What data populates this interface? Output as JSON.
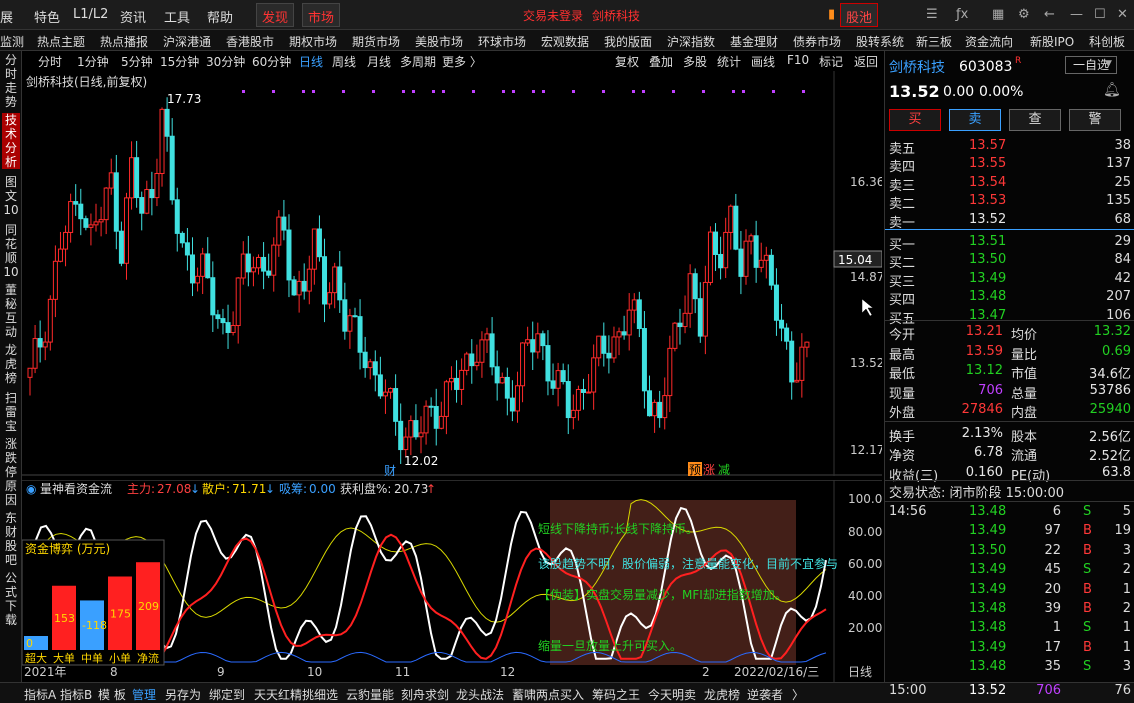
{
  "topbar": {
    "menu": [
      "展",
      "特色",
      "L1/L2",
      "资讯",
      "工具",
      "帮助"
    ],
    "discover": "发现",
    "market": "市场",
    "center_text": "交易未登录",
    "center_stock": "剑桥科技",
    "stock_pool": "股池"
  },
  "nav": [
    "监测",
    "热点主题",
    "热点播报",
    "沪深港通",
    "香港股市",
    "期权市场",
    "期货市场",
    "美股市场",
    "环球市场",
    "宏观数据",
    "我的版面",
    "沪深指数",
    "基金理财",
    "债券市场",
    "股转系统",
    "新三板",
    "资金流向",
    "新股IPO",
    "科创板"
  ],
  "sidebar": [
    "分时走势",
    "技术分析",
    "图文10",
    "同花顺10",
    "董秘互动",
    "龙虎榜",
    "扫雷宝",
    "涨跌停原因",
    "东财股吧",
    "公式下载"
  ],
  "periods": {
    "items": [
      "分时",
      "1分钟",
      "5分钟",
      "15分钟",
      "30分钟",
      "60分钟",
      "日线",
      "周线",
      "月线",
      "多周期",
      "更多 〉"
    ],
    "selected": "日线",
    "tools": [
      "复权",
      "叠加",
      "多股",
      "统计",
      "画线",
      "F10",
      "标记",
      "返回"
    ]
  },
  "chart": {
    "caption": "剑桥科技(日线,前复权)",
    "high_label": "17.73",
    "low_label": "12.02",
    "event_cai": "财",
    "event_yu": "预",
    "event_zhang": "涨",
    "event_jian": "减",
    "price_ticks": [
      "16.36",
      "15.04",
      "14.87",
      "13.52",
      "12.17"
    ],
    "current_price_tag": "15.04",
    "colors": {
      "up": "#ff2a2a",
      "down": "#40e0e0",
      "ma": "#ffffff"
    }
  },
  "chart_data": {
    "type": "candlestick",
    "title": "剑桥科技(日线,前复权)",
    "ylim": [
      11.8,
      18.0
    ],
    "close_path": [
      13.2,
      13.8,
      14.5,
      15.4,
      15.8,
      16.2,
      15.5,
      15.9,
      16.4,
      15.4,
      16.6,
      15.9,
      16.3,
      17.6,
      16.1,
      15.3,
      15.1,
      14.9,
      14.4,
      14.0,
      14.3,
      14.9,
      15.2,
      15.0,
      15.3,
      15.6,
      14.6,
      14.8,
      15.3,
      14.7,
      14.9,
      14.1,
      13.9,
      13.7,
      13.1,
      12.9,
      12.5,
      12.3,
      12.2,
      12.5,
      12.7,
      12.9,
      13.1,
      13.4,
      13.8,
      13.6,
      13.2,
      12.9,
      13.1,
      13.7,
      13.9,
      13.4,
      13.0,
      12.7,
      12.9,
      13.2,
      13.5,
      13.8,
      13.9,
      14.3,
      13.9,
      12.7,
      12.6,
      13.4,
      14.3,
      14.8,
      14.0,
      15.3,
      15.4,
      15.8,
      14.9,
      15.5,
      15.3,
      14.6,
      13.9,
      13.4,
      13.5
    ]
  },
  "indicator": {
    "name": "量神看资金流",
    "main_label": "主力:",
    "main_val": "27.08",
    "retail_label": "散户:",
    "retail_val": "71.71",
    "absorb_label": "吸筹:",
    "absorb_val": "0.00",
    "profit_label": "获利盘%:",
    "profit_val": "20.73",
    "ticks": [
      "100.0",
      "80.00",
      "60.00",
      "40.00",
      "20.00"
    ],
    "texts": [
      "短线下降持币;长线下降持币。",
      "该股趋势不明，股价偏弱，注意量能变化，目前不宜参与",
      "【伪装】实盘交易量减少，MFI却进指数增加。",
      "缩量一旦放量上升可买入。"
    ],
    "box_title": "资金博弈 (万元)",
    "box_values": [
      "0",
      "153",
      "-118",
      "175",
      "209"
    ],
    "box_labels": [
      "超大",
      "大单",
      "中单",
      "小单",
      "净流"
    ],
    "dates": [
      "2021年",
      "8",
      "9",
      "10",
      "11",
      "12",
      "2",
      "2022/02/16/三",
      "日线"
    ]
  },
  "bottom": [
    "指标A",
    "指标B",
    "模 板",
    "管理",
    "另存为",
    "绑定到",
    "天天红精挑细选",
    "云豹量能",
    "刻舟求剑",
    "龙头战法",
    "蓄啸两点买入",
    "筹码之王",
    "今天明卖",
    "龙虎榜",
    "逆袭者",
    "〉"
  ],
  "right": {
    "stock_name": "剑桥科技",
    "code": "603083",
    "watch_btn": "一自选",
    "price": "13.52",
    "change": "0.00",
    "pct": "0.00%",
    "buttons": [
      "买",
      "卖",
      "查",
      "警"
    ],
    "asks": [
      {
        "label": "卖五",
        "price": "13.57",
        "vol": "38"
      },
      {
        "label": "卖四",
        "price": "13.55",
        "vol": "137"
      },
      {
        "label": "卖三",
        "price": "13.54",
        "vol": "25"
      },
      {
        "label": "卖二",
        "price": "13.53",
        "vol": "135"
      },
      {
        "label": "卖一",
        "price": "13.52",
        "vol": "68"
      }
    ],
    "bids": [
      {
        "label": "买一",
        "price": "13.51",
        "vol": "29"
      },
      {
        "label": "买二",
        "price": "13.50",
        "vol": "84"
      },
      {
        "label": "买三",
        "price": "13.49",
        "vol": "42"
      },
      {
        "label": "买四",
        "price": "13.48",
        "vol": "207"
      },
      {
        "label": "买五",
        "price": "13.47",
        "vol": "106"
      }
    ],
    "stats": [
      [
        "今开",
        "13.21",
        "均价",
        "13.32"
      ],
      [
        "最高",
        "13.59",
        "量比",
        "0.69"
      ],
      [
        "最低",
        "13.12",
        "市值",
        "34.6亿"
      ],
      [
        "现量",
        "706",
        "总量",
        "53786"
      ],
      [
        "外盘",
        "27846",
        "内盘",
        "25940"
      ],
      [
        "换手",
        "2.13%",
        "股本",
        "2.56亿"
      ],
      [
        "净资",
        "6.78",
        "流通",
        "2.52亿"
      ],
      [
        "收益(三)",
        "0.160",
        "PE(动)",
        "63.8"
      ]
    ],
    "status": "交易状态: 闭市阶段 15:00:00",
    "ticks": [
      {
        "t": "14:56",
        "p": "13.48",
        "v": "6",
        "d": "S",
        "n": "5"
      },
      {
        "t": "",
        "p": "13.49",
        "v": "97",
        "d": "B",
        "n": "19"
      },
      {
        "t": "",
        "p": "13.50",
        "v": "22",
        "d": "B",
        "n": "3"
      },
      {
        "t": "",
        "p": "13.49",
        "v": "45",
        "d": "S",
        "n": "2"
      },
      {
        "t": "",
        "p": "13.49",
        "v": "20",
        "d": "B",
        "n": "1"
      },
      {
        "t": "",
        "p": "13.48",
        "v": "39",
        "d": "B",
        "n": "2"
      },
      {
        "t": "",
        "p": "13.48",
        "v": "1",
        "d": "S",
        "n": "1"
      },
      {
        "t": "",
        "p": "13.49",
        "v": "17",
        "d": "B",
        "n": "1"
      },
      {
        "t": "",
        "p": "13.48",
        "v": "35",
        "d": "S",
        "n": "3"
      },
      {
        "t": "15:00",
        "p": "13.52",
        "v": "706",
        "d": "",
        "n": "76"
      }
    ]
  }
}
